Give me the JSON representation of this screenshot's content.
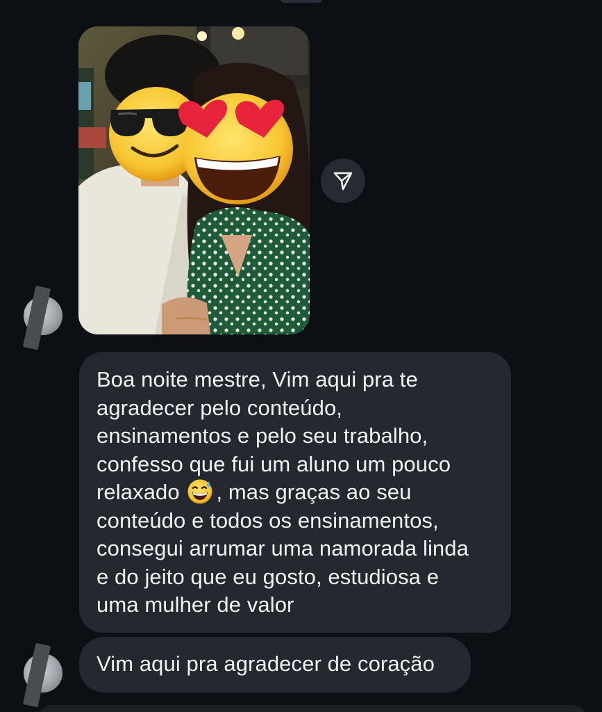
{
  "conversation": {
    "photo_message": {
      "alt": "",
      "share_icon": "send-icon"
    },
    "messages": [
      {
        "lines": [
          "Boa noite mestre, Vim aqui pra te",
          "agradecer pelo conteúdo,",
          "ensinamentos e pelo seu trabalho,",
          "confesso que fui um aluno um pouco",
          "relaxado",
          ", mas graças ao seu",
          "conteúdo e todos os ensinamentos,",
          "consegui arrumar uma namorada linda",
          "e do jeito que eu gosto, estudiosa e",
          "uma mulher de valor"
        ],
        "inline_emoji": "grinning-face-with-sweat-emoji"
      },
      {
        "text": "Vim aqui pra agradecer de coração"
      }
    ]
  },
  "colors": {
    "background": "#0c0f14",
    "bubble": "#25282e",
    "text": "#f1f2f4"
  }
}
